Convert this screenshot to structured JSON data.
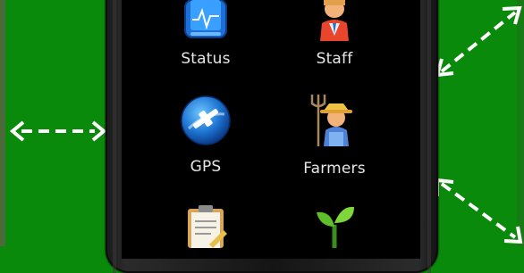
{
  "apps": [
    {
      "label": "Status",
      "icon": "status-monitor-icon"
    },
    {
      "label": "Staff",
      "icon": "staff-person-icon"
    },
    {
      "label": "GPS",
      "icon": "gps-satellite-icon"
    },
    {
      "label": "Farmers",
      "icon": "farmer-pitchfork-icon"
    },
    {
      "label": "",
      "icon": "clipboard-icon"
    },
    {
      "label": "",
      "icon": "seedling-icon"
    }
  ],
  "colors": {
    "background": "#0a8a0a",
    "arrow": "#ffffff",
    "screen": "#000000",
    "label_text": "#e6e6e6"
  }
}
